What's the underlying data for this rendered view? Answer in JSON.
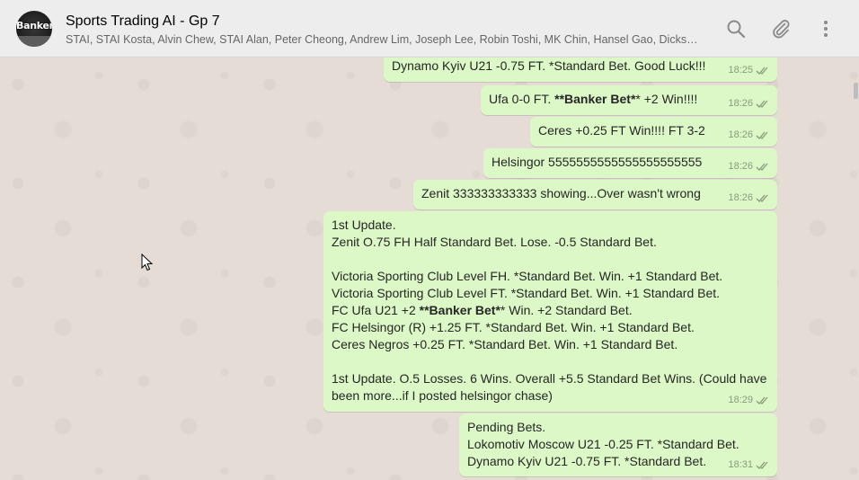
{
  "header": {
    "avatar_text": "Banker",
    "title": "Sports Trading AI - Gp 7",
    "subtitle": "STAI, STAI Kosta, Alvin Chew, STAI Alan, Peter Cheong, Andrew Lim, Joseph Lee, Robin Toshi, MK Chin, Hansel Gao, Dickso…"
  },
  "icons": {
    "search": "search-icon",
    "attach": "paperclip-icon",
    "menu": "kebab-menu-icon",
    "read": "double-check-icon"
  },
  "colors": {
    "header_bg": "#ededed",
    "chat_bg": "#e5ddd5",
    "outgoing_bubble": "#dcf8c6",
    "read_ticks": "#8a9a7e"
  },
  "messages": [
    {
      "pre": "Dynamo Kyiv U21 -0.75 FT. *Standard Bet. Good Luck!!!",
      "bold": "",
      "post": "",
      "time": "18:25"
    },
    {
      "pre": "Ufa 0-0 FT. ",
      "bold": "**Banker Bet*",
      "post": "* +2 Win!!!!",
      "time": "18:26"
    },
    {
      "pre": "Ceres +0.25 FT Win!!!! FT 3-2",
      "bold": "",
      "post": "",
      "time": "18:26"
    },
    {
      "pre": "Helsingor 5555555555555555555555",
      "bold": "",
      "post": "",
      "time": "18:26"
    },
    {
      "pre": "Zenit 333333333333 showing...Over wasn't wrong",
      "bold": "",
      "post": "",
      "time": "18:26"
    },
    {
      "pre": "1st Update.\nZenit O.75 FH Half Standard Bet. Lose. -0.5 Standard Bet.\n\nVictoria Sporting Club Level FH. *Standard Bet. Win. +1 Standard Bet.\nVictoria Sporting Club Level FT. *Standard Bet. Win. +1 Standard Bet.\nFC Ufa U21 +2 ",
      "bold": "**Banker Bet*",
      "post": "* Win. +2 Standard Bet.\nFC Helsingor (R) +1.25 FT. *Standard Bet. Win. +1 Standard Bet.\nCeres Negros +0.25 FT. *Standard Bet. Win. +1 Standard Bet.\n\n1st Update. O.5 Losses. 6 Wins. Overall +5.5 Standard Bet Wins. (Could have\nbeen more...if I posted helsingor chase)",
      "time": "18:29"
    },
    {
      "pre": "Pending Bets.\nLokomotiv Moscow U21 -0.25 FT. *Standard Bet.\nDynamo Kyiv U21 -0.75 FT. *Standard Bet.",
      "bold": "",
      "post": "",
      "time": "18:31"
    }
  ]
}
